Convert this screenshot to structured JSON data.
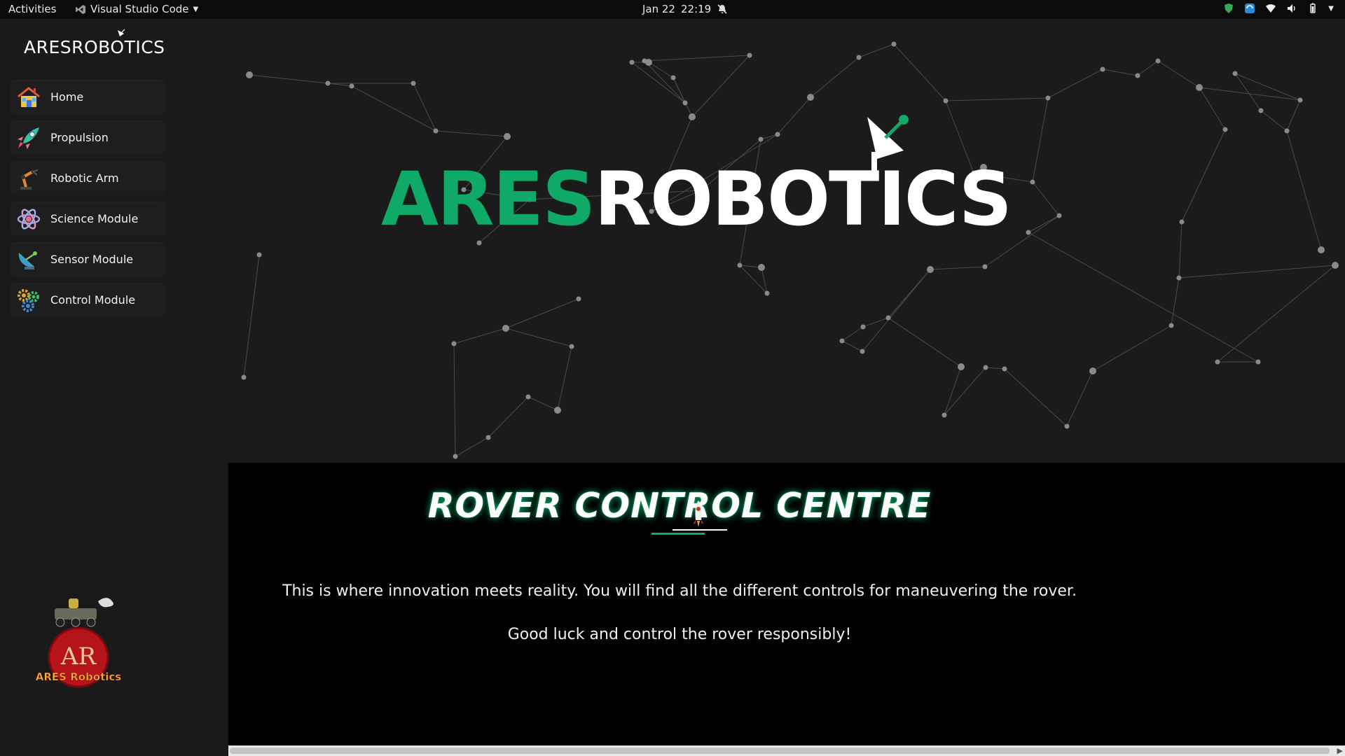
{
  "topbar": {
    "activities": "Activities",
    "app_name": "Visual Studio Code",
    "date": "Jan 22",
    "time": "22:19"
  },
  "sidebar": {
    "brand": "ARESROBOTICS",
    "items": [
      {
        "label": "Home",
        "icon": "house-icon"
      },
      {
        "label": "Propulsion",
        "icon": "rocket-icon"
      },
      {
        "label": "Robotic Arm",
        "icon": "robotic-arm-icon"
      },
      {
        "label": "Science Module",
        "icon": "atom-icon"
      },
      {
        "label": "Sensor Module",
        "icon": "satellite-dish-icon"
      },
      {
        "label": "Control Module",
        "icon": "gears-icon"
      }
    ],
    "mascot_text": "AR",
    "mascot_caption": "ARES Robotics"
  },
  "hero": {
    "title_green": "ARES",
    "title_white": "ROBOTICS"
  },
  "main": {
    "title": "ROVER CONTROL CENTRE",
    "paragraph1": "This is where innovation meets reality. You will find all the different controls for maneuvering the rover.",
    "paragraph2": "Good luck and control the rover responsibly!"
  },
  "colors": {
    "accent": "#0fa968",
    "sidebar_bg": "#1a1a1a",
    "hero_bg": "#1b1b1c",
    "content_bg": "#000000"
  }
}
